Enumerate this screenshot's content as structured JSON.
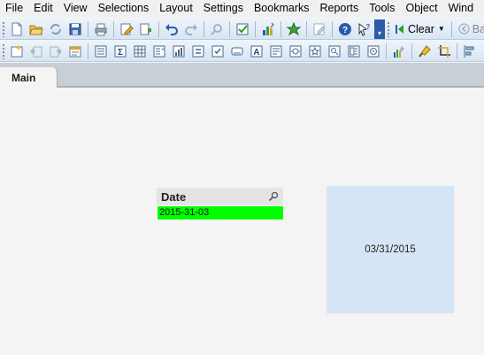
{
  "menu": [
    "File",
    "Edit",
    "View",
    "Selections",
    "Layout",
    "Settings",
    "Bookmarks",
    "Reports",
    "Tools",
    "Object",
    "Wind"
  ],
  "toolbar1": {
    "clear_label": "Clear",
    "back_label": "Back"
  },
  "tabs": [
    {
      "label": "Main"
    }
  ],
  "listbox": {
    "title": "Date",
    "selected_value": "2015-31-03",
    "selected_color": "#00ff00"
  },
  "text_object": {
    "text": "03/31/2015",
    "background": "#d6e5f5"
  }
}
